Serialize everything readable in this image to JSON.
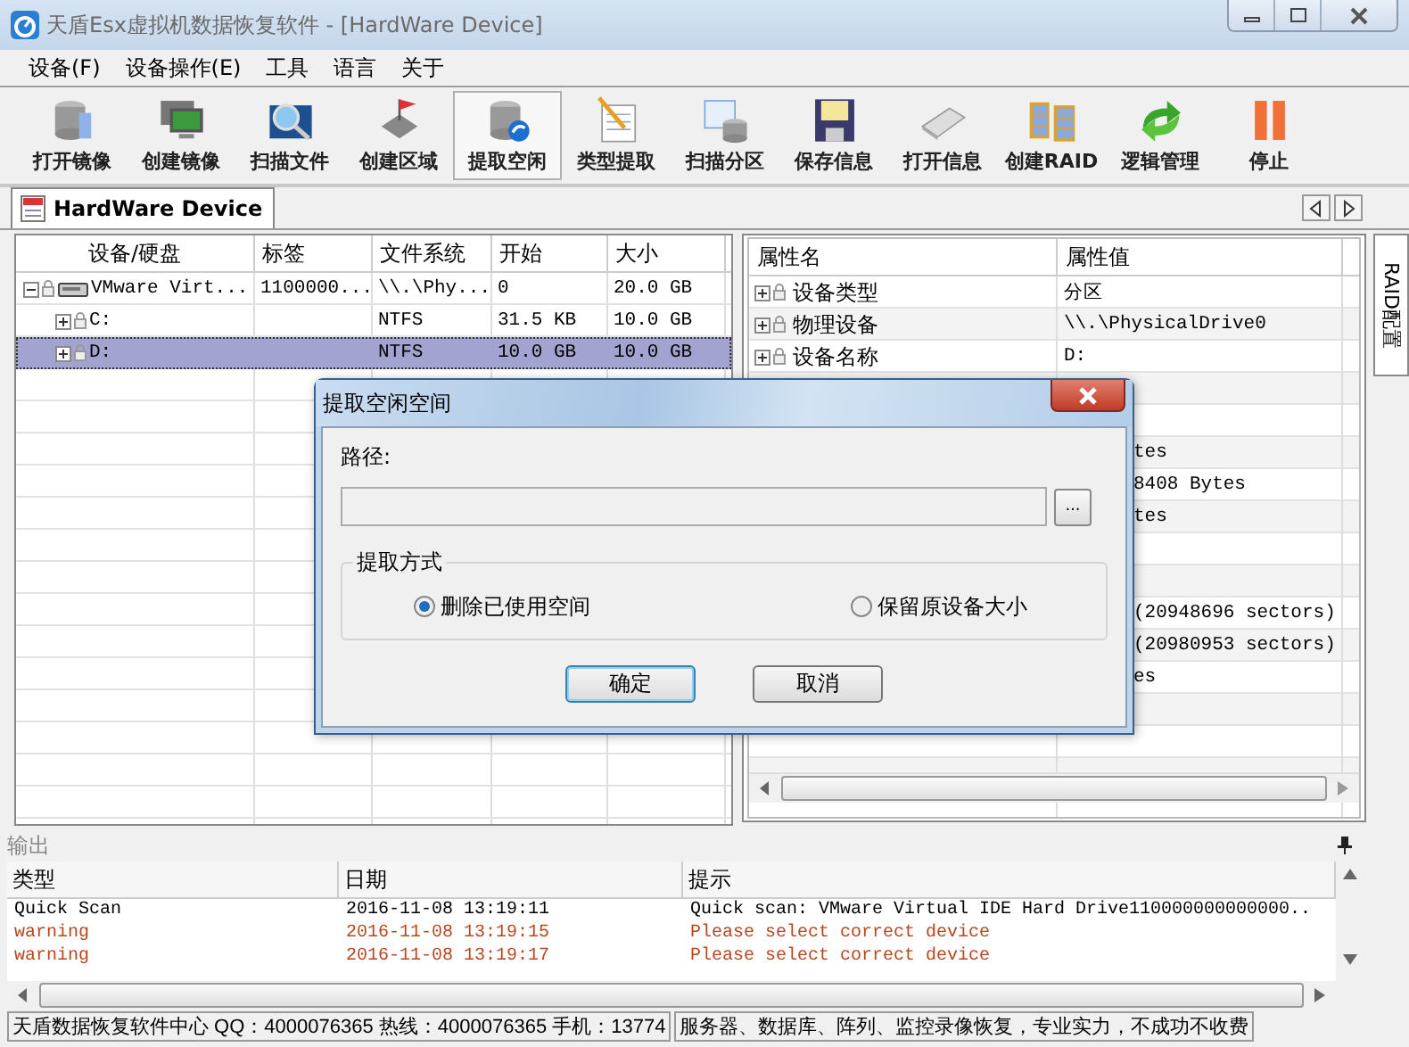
{
  "window": {
    "title": "天盾Esx虚拟机数据恢复软件 - [HardWare Device]"
  },
  "menu": [
    "设备(F)",
    "设备操作(E)",
    "工具",
    "语言",
    "关于"
  ],
  "toolbar": [
    {
      "label": "打开镜像",
      "selected": false
    },
    {
      "label": "创建镜像",
      "selected": false
    },
    {
      "label": "扫描文件",
      "selected": false
    },
    {
      "label": "创建区域",
      "selected": false
    },
    {
      "label": "提取空闲",
      "selected": true
    },
    {
      "label": "类型提取",
      "selected": false
    },
    {
      "label": "扫描分区",
      "selected": false
    },
    {
      "label": "保存信息",
      "selected": false
    },
    {
      "label": "打开信息",
      "selected": false
    },
    {
      "label": "创建RAID",
      "selected": false
    },
    {
      "label": "逻辑管理",
      "selected": false
    },
    {
      "label": "停止",
      "selected": false
    }
  ],
  "document_tab": {
    "label": "HardWare Device"
  },
  "side_tab": {
    "label": "RAID配置"
  },
  "device_table": {
    "columns": [
      "设备/硬盘",
      "标签",
      "文件系统",
      "开始",
      "大小"
    ],
    "rows": [
      {
        "device": "VMware Virt...",
        "label": "1100000...",
        "filesystem": "\\\\.\\Phy...",
        "start": "0",
        "size": "20.0 GB",
        "expanded": true,
        "selected": false,
        "children": [
          {
            "device": "C:",
            "filesystem": "NTFS",
            "start": "31.5 KB",
            "size": "10.0 GB",
            "expanded": false,
            "selected": false
          },
          {
            "device": "D:",
            "filesystem": "NTFS",
            "start": "10.0 GB",
            "size": "10.0 GB",
            "expanded": false,
            "selected": true
          }
        ]
      }
    ]
  },
  "property_table": {
    "columns": [
      "属性名",
      "属性值"
    ],
    "rows": [
      {
        "name": "设备类型",
        "value": "分区",
        "expanded": false
      },
      {
        "name": "物理设备",
        "value": "\\\\.\\PhysicalDrive0",
        "expanded": false
      },
      {
        "name": "设备名称",
        "value": "D:",
        "expanded": false
      },
      null,
      null,
      {
        "value": "tes"
      },
      {
        "value": "8408 Bytes"
      },
      {
        "value": "tes"
      },
      null,
      null,
      {
        "value": "(20948696 sectors)"
      },
      {
        "value": "(20980953 sectors)"
      },
      {
        "value": "es"
      },
      null
    ]
  },
  "dialog": {
    "title": "提取空闲空间",
    "path_label": "路径:",
    "browse_button": "...",
    "group_label": "提取方式",
    "options": [
      {
        "label": "删除已使用空间",
        "selected": true
      },
      {
        "label": "保留原设备大小",
        "selected": false
      }
    ],
    "buttons": [
      {
        "label": "确定",
        "default": true
      },
      {
        "label": "取消",
        "default": false
      }
    ]
  },
  "output": {
    "title": "输出",
    "columns": [
      "类型",
      "日期",
      "提示"
    ],
    "rows": [
      {
        "kind": "info",
        "type": "Quick Scan",
        "date": "2016-11-08 13:19:11",
        "message": "Quick scan: VMware Virtual IDE Hard Drive110000000000000.."
      },
      {
        "kind": "warning",
        "type": "warning",
        "date": "2016-11-08 13:19:15",
        "message": "Please select correct device"
      },
      {
        "kind": "warning",
        "type": "warning",
        "date": "2016-11-08 13:19:17",
        "message": "Please select correct device"
      }
    ]
  },
  "status_bar": [
    "天盾数据恢复软件中心 QQ：4000076365 热线：4000076365 手机：13774",
    "服务器、数据库、阵列、监控录像恢复，专业实力，不成功不收费"
  ]
}
